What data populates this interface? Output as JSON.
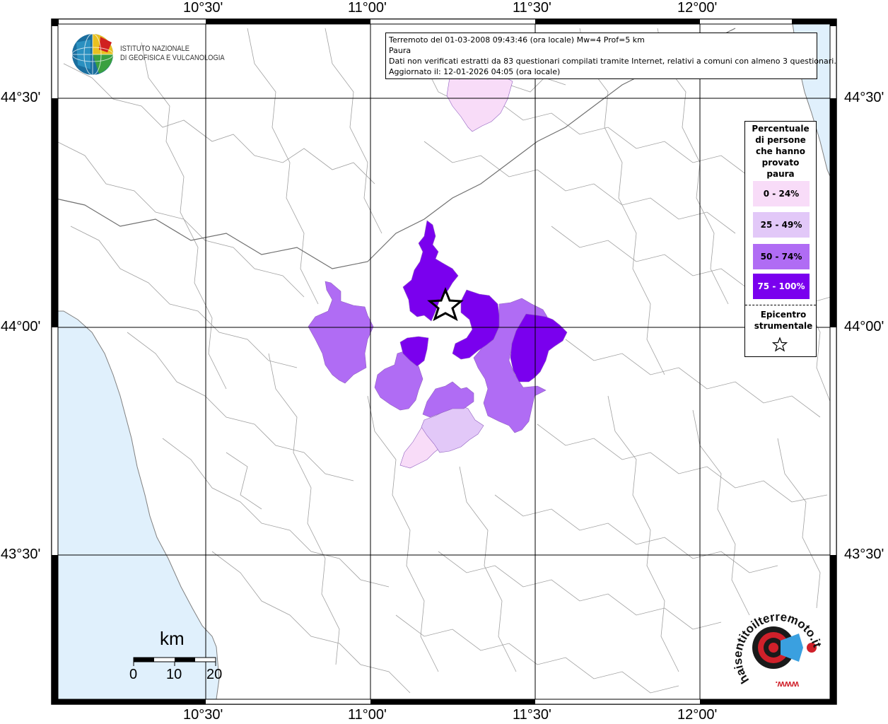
{
  "info_box": {
    "line1": "Terremoto del 01-03-2008 09:43:46 (ora locale) Mw=4 Prof=5 km",
    "line2": "Paura",
    "line3": "Dati non verificati estratti da 83 questionari compilati tramite Internet, relativi a comuni con almeno 3 questionari.",
    "line4": "Aggiornato il: 12-01-2026 04:05 (ora locale)"
  },
  "logo": {
    "line1": "ISTITUTO NAZIONALE",
    "line2": "DI GEOFISICA E VULCANOLOGIA",
    "icon": "globe-icon"
  },
  "axes": {
    "longitude_ticks": [
      "10°30'",
      "11°00'",
      "11°30'",
      "12°00'"
    ],
    "latitude_ticks": [
      "44°30'",
      "44°00'",
      "43°30'"
    ]
  },
  "legend": {
    "title": "Percentuale di persone che hanno provato paura",
    "classes": [
      {
        "label": "0 - 24%",
        "color": "#f8dcf8"
      },
      {
        "label": "25 - 49%",
        "color": "#e2c8f8"
      },
      {
        "label": "50 - 74%",
        "color": "#b06cf4"
      },
      {
        "label": "75 - 100%",
        "color": "#7a00ee"
      }
    ],
    "epicenter_label": "Epicentro strumentale",
    "epicenter_icon": "star-icon"
  },
  "scale_bar": {
    "unit": "km",
    "labels": [
      "0",
      "10",
      "20"
    ]
  },
  "badge": {
    "text": "haisentitoilterremoto.it",
    "prefix": "www.",
    "icon": "target-speaker-icon"
  },
  "colors": {
    "sea": "#e0f0fc",
    "grid": "#000000",
    "borders": "#a0a0a0"
  }
}
